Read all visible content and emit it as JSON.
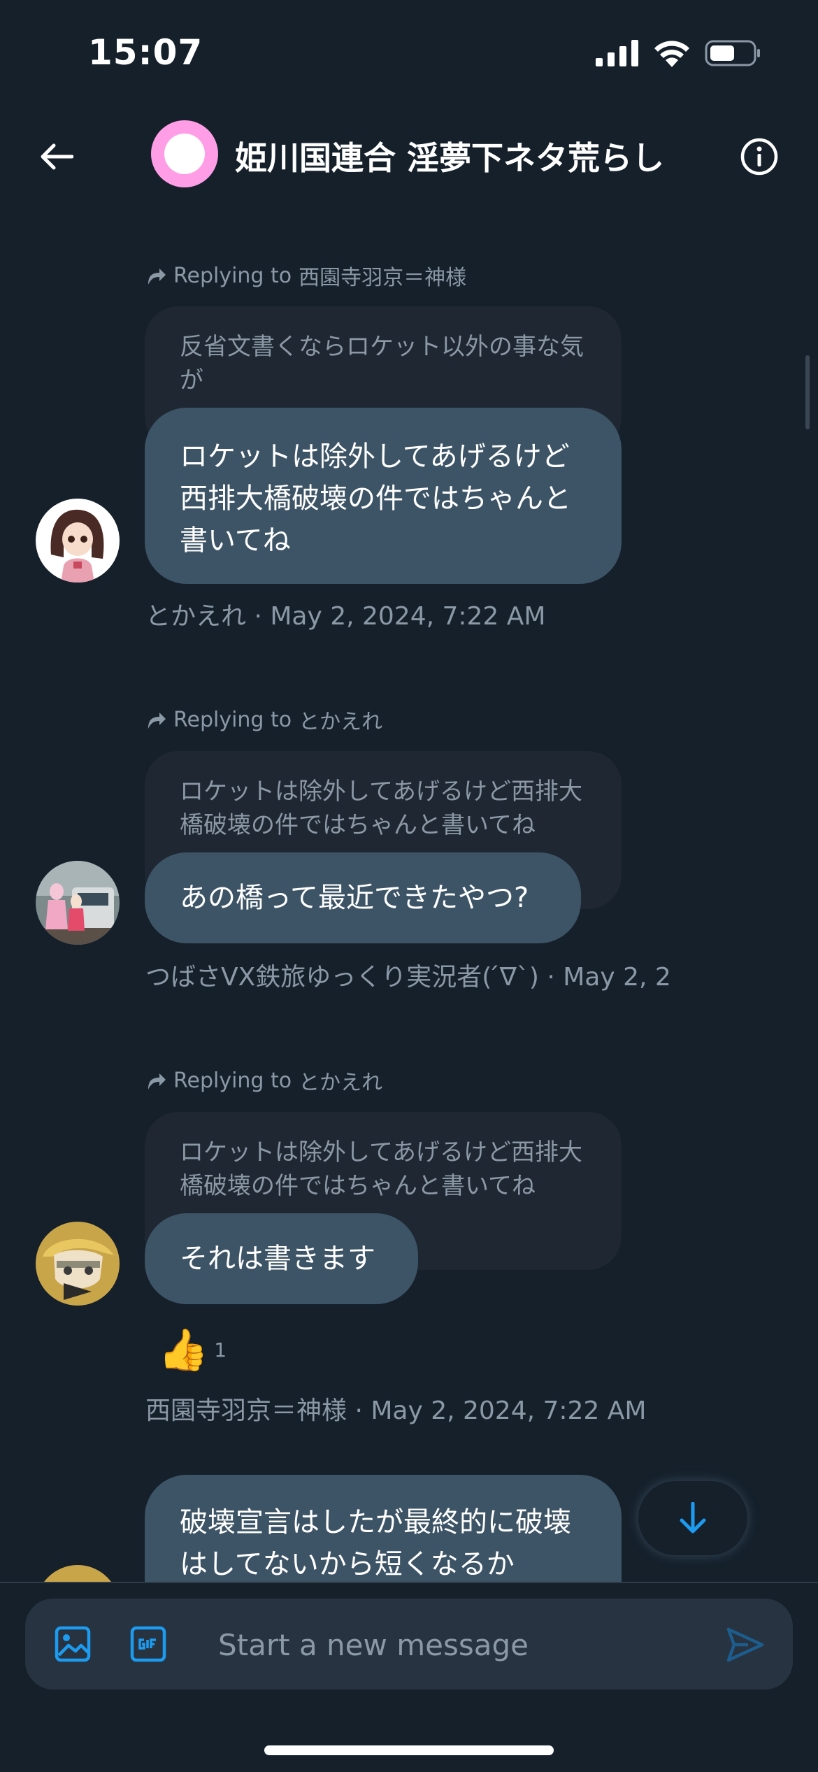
{
  "status_bar": {
    "time": "15:07"
  },
  "header": {
    "title": "姫川国連合 淫夢下ネタ荒らし"
  },
  "messages": [
    {
      "reply_label": "Replying to",
      "reply_to": "西園寺羽京＝神様",
      "quoted_text": "反省文書くならロケット以外の事な気が",
      "text": "ロケットは除外してあげるけど西排大橋破壊の件ではちゃんと書いてね",
      "meta": "とかえれ · May 2, 2024, 7:22 AM"
    },
    {
      "reply_label": "Replying to",
      "reply_to": "とかえれ",
      "quoted_text": "ロケットは除外してあげるけど西排大橋破壊の件ではちゃんと書いてね",
      "text": "あの橋って最近できたやつ?",
      "meta": "つばさVX鉄旅ゆっくり実況者( ́∇`) · May 2, 2"
    },
    {
      "reply_label": "Replying to",
      "reply_to": "とかえれ",
      "quoted_text": "ロケットは除外してあげるけど西排大橋破壊の件ではちゃんと書いてね",
      "text": "それは書きます",
      "reaction": {
        "emoji": "👍",
        "count": "1"
      },
      "meta": "西園寺羽京＝神様 · May 2, 2024, 7:22 AM"
    },
    {
      "text": "破壊宣言はしたが最終的に破壊はしてないから短くなるか"
    }
  ],
  "composer": {
    "placeholder": "Start a new message"
  },
  "colors": {
    "background": "#15202b",
    "bubble": "#3d5466",
    "quoted": "#1e2732",
    "accent": "#1d9bf0",
    "muted": "#8b98a5"
  }
}
